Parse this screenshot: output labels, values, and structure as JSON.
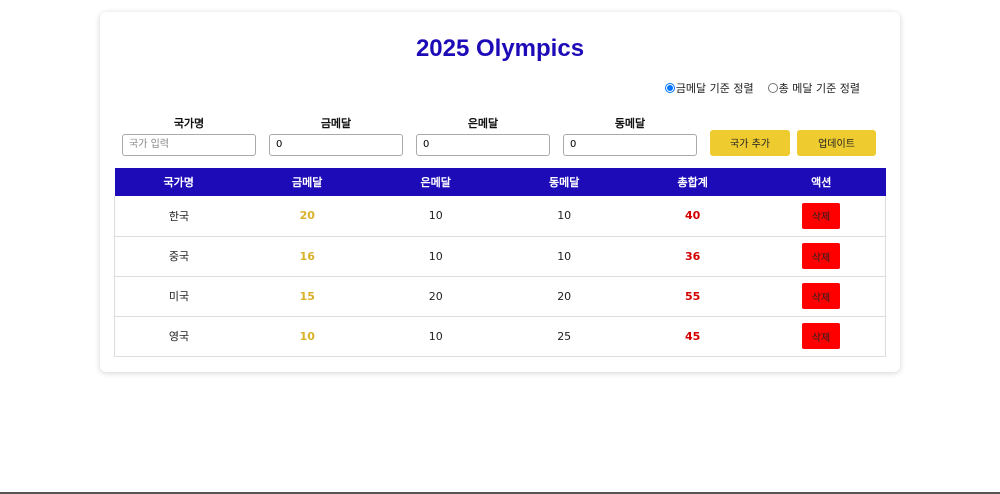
{
  "title": "2025 Olympics",
  "sort": {
    "options": [
      {
        "label": "금메달 기준 정렬",
        "checked": true
      },
      {
        "label": "총 메달 기준 정렬",
        "checked": false
      }
    ]
  },
  "form": {
    "country": {
      "label": "국가명",
      "placeholder": "국가 입력",
      "value": ""
    },
    "gold": {
      "label": "금메달",
      "value": "0"
    },
    "silver": {
      "label": "은메달",
      "value": "0"
    },
    "bronze": {
      "label": "동메달",
      "value": "0"
    },
    "add_label": "국가 추가",
    "update_label": "업데이트"
  },
  "table": {
    "headers": [
      "국가명",
      "금메달",
      "은메달",
      "동메달",
      "총합계",
      "액션"
    ],
    "rows": [
      {
        "country": "한국",
        "gold": "20",
        "silver": "10",
        "bronze": "10",
        "total": "40",
        "action": "삭제"
      },
      {
        "country": "중국",
        "gold": "16",
        "silver": "10",
        "bronze": "10",
        "total": "36",
        "action": "삭제"
      },
      {
        "country": "미국",
        "gold": "15",
        "silver": "20",
        "bronze": "20",
        "total": "55",
        "action": "삭제"
      },
      {
        "country": "영국",
        "gold": "10",
        "silver": "10",
        "bronze": "25",
        "total": "45",
        "action": "삭제"
      }
    ]
  },
  "colors": {
    "accent": "#1e0bb8",
    "button_yellow": "#eecb2f",
    "delete_red": "#ff0000",
    "gold_text": "#d9b12a",
    "total_text": "#d40000"
  }
}
